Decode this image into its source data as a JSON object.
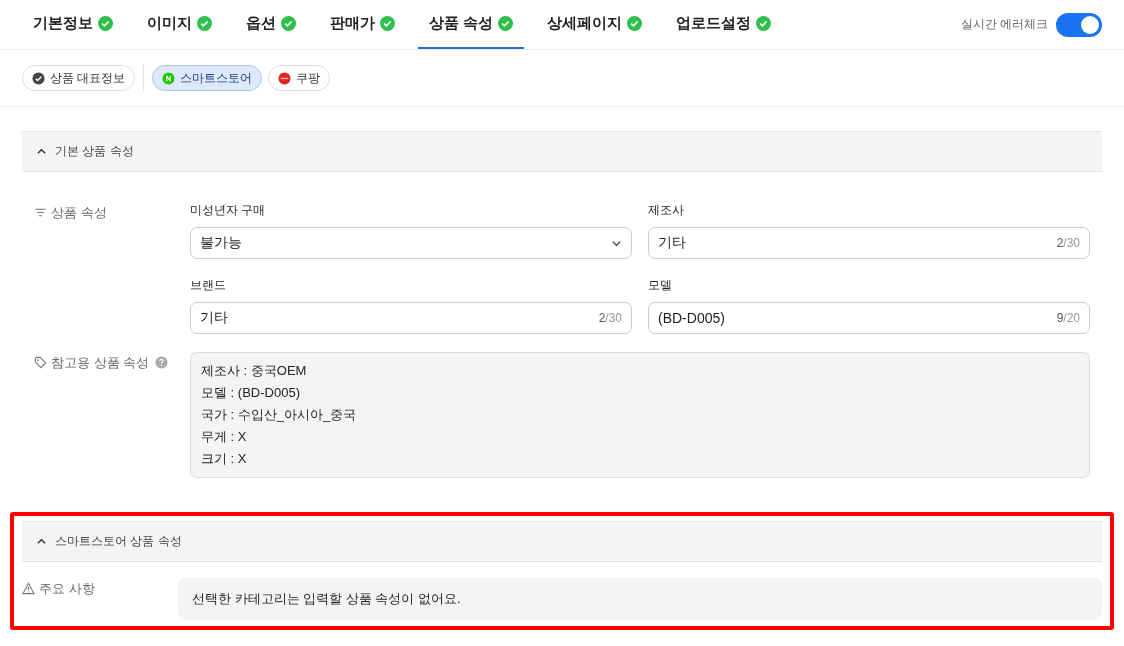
{
  "tabs": [
    {
      "label": "기본정보",
      "complete": true,
      "selected": false
    },
    {
      "label": "이미지",
      "complete": true,
      "selected": false
    },
    {
      "label": "옵션",
      "complete": true,
      "selected": false
    },
    {
      "label": "판매가",
      "complete": true,
      "selected": false
    },
    {
      "label": "상품 속성",
      "complete": true,
      "selected": true
    },
    {
      "label": "상세페이지",
      "complete": true,
      "selected": false
    },
    {
      "label": "업로드설정",
      "complete": true,
      "selected": false
    }
  ],
  "error_check": {
    "label": "실시간 에러체크",
    "on": true
  },
  "channels": [
    {
      "label": "상품 대표정보",
      "kind": "summary",
      "selected": false
    },
    {
      "label": "스마트스토어",
      "kind": "naver",
      "selected": true
    },
    {
      "label": "쿠팡",
      "kind": "coupang",
      "selected": false
    }
  ],
  "sections": [
    {
      "title": "기본 상품 속성",
      "expanded": true,
      "highlighted": false,
      "rows": [
        {
          "label": "상품 속성",
          "kind": "fields",
          "fields": [
            {
              "label": "미성년자 구매",
              "kind": "select",
              "value": "불가능"
            },
            {
              "label": "제조사",
              "kind": "text",
              "value": "기타",
              "count": "2",
              "limit": "/30"
            },
            {
              "label": "브랜드",
              "kind": "text",
              "value": "기타",
              "count": "2",
              "limit": "/30"
            },
            {
              "label": "모델",
              "kind": "text",
              "value": "(BD-D005)",
              "count": "9",
              "limit": "/20"
            }
          ]
        },
        {
          "label": "참고용 상품 속성",
          "kind": "reference",
          "help": true,
          "lines": [
            "제조사 : 중국OEM",
            "모델 : (BD-D005)",
            "국가 : 수입산_아시아_중국",
            "무게 : X",
            "크기 : X"
          ]
        }
      ]
    },
    {
      "title": "스마트스토어 상품 속성",
      "expanded": true,
      "highlighted": true,
      "rows": [
        {
          "label": "주요 사항",
          "kind": "notice",
          "text": "선택한 카테고리는 입력할 상품 속성이 없어요."
        }
      ]
    }
  ]
}
